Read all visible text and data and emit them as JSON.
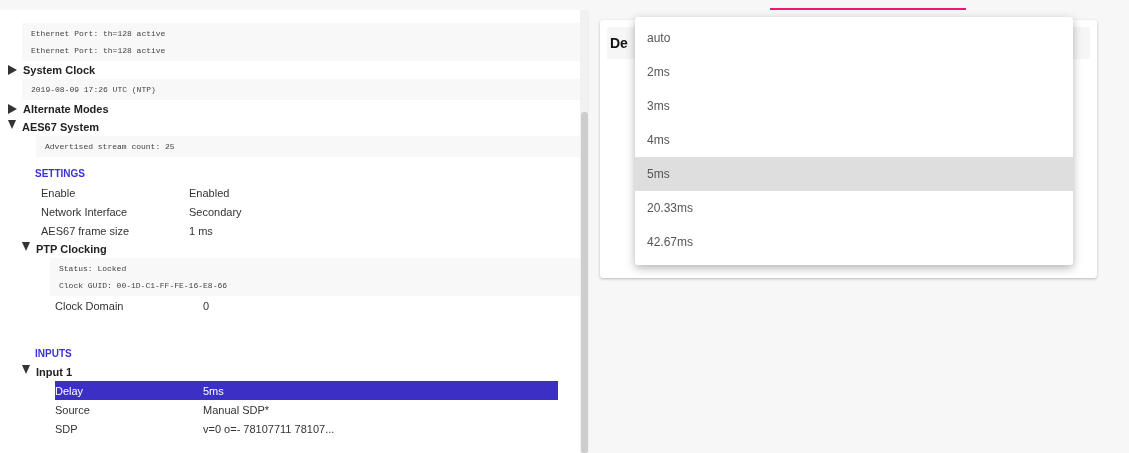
{
  "tree": [
    {
      "kind": "info",
      "lines": [
        "Ethernet Port: th=128 active",
        "Ethernet Port: th=128 active"
      ]
    },
    {
      "kind": "node",
      "label": "System Clock",
      "expanded": false
    },
    {
      "kind": "info",
      "lines": [
        "2019-08-09 17:26 UTC (NTP)"
      ]
    },
    {
      "kind": "node",
      "label": "Alternate Modes",
      "expanded": false
    },
    {
      "kind": "node",
      "label": "AES67 System",
      "expanded": true,
      "children": [
        {
          "kind": "info",
          "lines": [
            "Advertised stream count: 25"
          ]
        },
        {
          "kind": "heading",
          "label": "SETTINGS"
        },
        {
          "kind": "prop",
          "label": "Enable",
          "value": "Enabled",
          "selected": false
        },
        {
          "kind": "prop",
          "label": "Network Interface",
          "value": "Secondary",
          "selected": false
        },
        {
          "kind": "prop",
          "label": "AES67 frame size",
          "value": "1 ms",
          "selected": false
        },
        {
          "kind": "node",
          "label": "PTP Clocking",
          "expanded": true,
          "children": [
            {
              "kind": "info",
              "lines": [
                "Status: Locked",
                "Clock GUID: 00-1D-C1-FF-FE-16-E8-66"
              ]
            },
            {
              "kind": "prop",
              "label": "Clock Domain",
              "value": "0",
              "selected": false
            }
          ]
        },
        {
          "kind": "spacer"
        },
        {
          "kind": "heading",
          "label": "INPUTS"
        },
        {
          "kind": "node",
          "label": "Input 1",
          "expanded": true,
          "children": [
            {
              "kind": "prop",
              "label": "Delay",
              "value": "5ms",
              "selected": true
            },
            {
              "kind": "prop",
              "label": "Source",
              "value": "Manual SDP*",
              "selected": false
            },
            {
              "kind": "prop",
              "label": "SDP",
              "value": "v=0 o=- 78107711 78107...",
              "selected": false
            }
          ]
        }
      ]
    }
  ],
  "card": {
    "title": "De"
  },
  "dropdown": {
    "options": [
      {
        "label": "auto",
        "selected": false
      },
      {
        "label": "2ms",
        "selected": false
      },
      {
        "label": "3ms",
        "selected": false
      },
      {
        "label": "4ms",
        "selected": false
      },
      {
        "label": "5ms",
        "selected": true
      },
      {
        "label": "20.33ms",
        "selected": false
      },
      {
        "label": "42.67ms",
        "selected": false
      }
    ]
  }
}
